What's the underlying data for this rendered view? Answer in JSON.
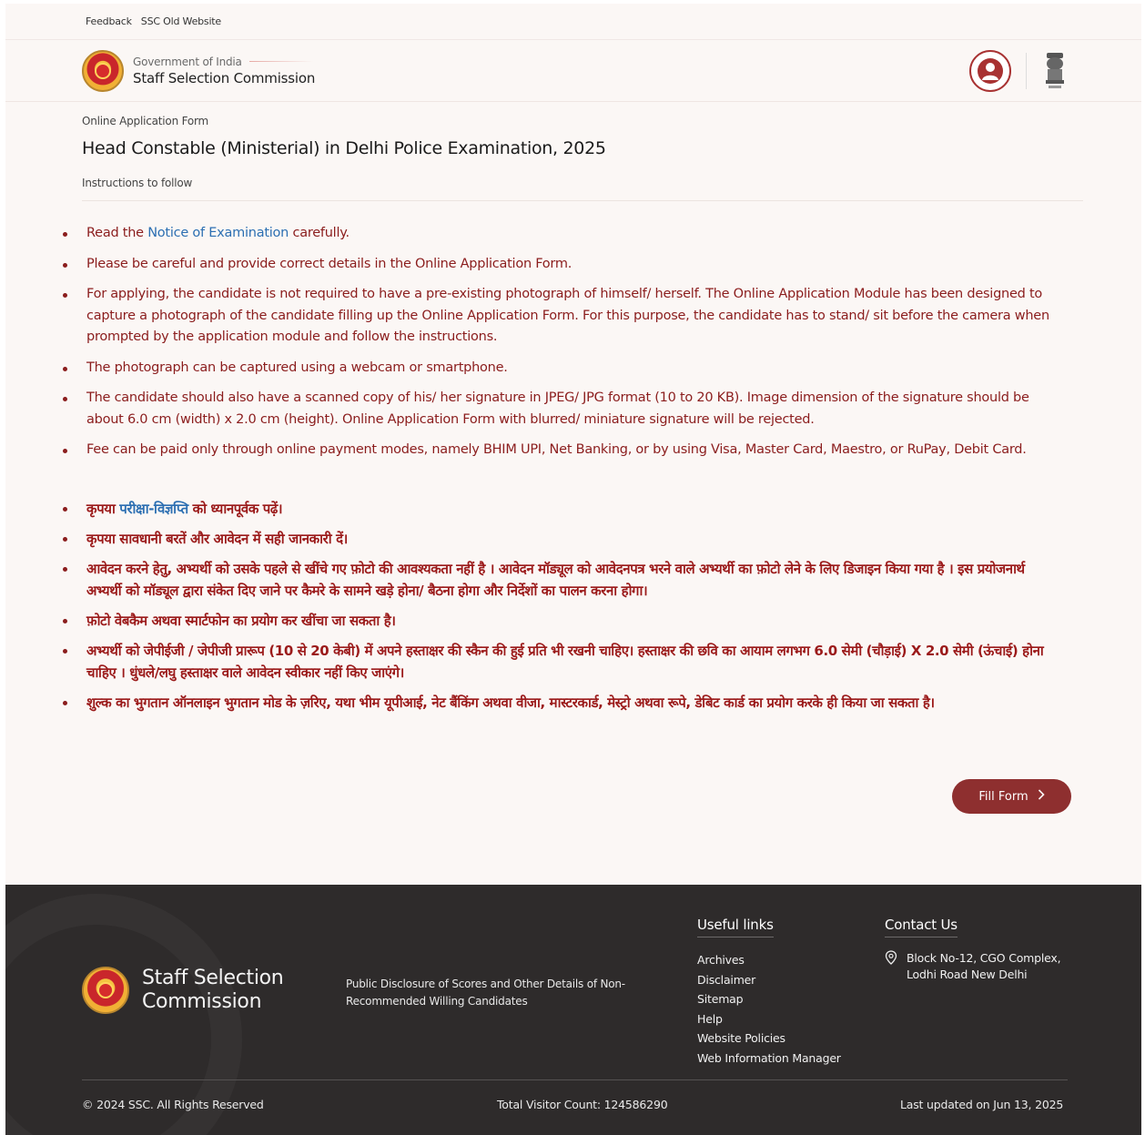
{
  "topbar": {
    "feedback": "Feedback",
    "old_site": "SSC Old Website"
  },
  "header": {
    "gov": "Government of India",
    "org": "Staff Selection Commission",
    "icons": [
      "ssc-emblem-icon",
      "user-profile-icon",
      "ashoka-emblem-icon"
    ]
  },
  "form": {
    "label": "Online Application Form",
    "title": "Head Constable (Ministerial) in Delhi Police Examination, 2025",
    "instructions_label": "Instructions to follow"
  },
  "english": {
    "item1_pre": "Read the ",
    "item1_link": "Notice of Examination",
    "item1_post": " carefully.",
    "item2": "Please be careful and provide correct details in the Online Application Form.",
    "item3": "For applying, the candidate is not required to have a pre-existing photograph of himself/ herself. The Online Application Module has been designed to capture a photograph of the candidate filling up the Online Application Form. For this purpose, the candidate has to stand/ sit before the camera when prompted by the application module and follow the instructions.",
    "item4": "The photograph can be captured using a webcam or smartphone.",
    "item5": "The candidate should also have a scanned copy of his/ her signature in JPEG/ JPG format (10 to 20 KB). Image dimension of the signature should be about 6.0 cm (width) x 2.0 cm (height). Online Application Form with blurred/ miniature signature will be rejected.",
    "item6": "Fee can be paid only through online payment modes, namely BHIM UPI, Net Banking, or by using Visa, Master Card, Maestro, or RuPay, Debit Card."
  },
  "hindi": {
    "item1_pre": "कृपया ",
    "item1_link": "परीक्षा-विज्ञप्ति",
    "item1_post": " को ध्यानपूर्वक पढ़ें।",
    "item2": "कृपया सावधानी बरतें और आवेदन में सही जानकारी दें।",
    "item3": "आवेदन करने हेतु, अभ्यर्थी को उसके पहले से खींचे गए फ़ोटो की आवश्यकता नहीं है । आवेदन मॉड्यूल को आवेदनपत्र भरने वाले अभ्यर्थी का फ़ोटो लेने के लिए डिजाइन किया गया है । इस प्रयोजनार्थ अभ्यर्थी को मॉड्यूल द्वारा संकेत दिए जाने पर कैमरे के सामने खड़े होना/ बैठना होगा और निर्देशों का पालन करना होगा।",
    "item4": "फ़ोटो वेबकैम अथवा स्मार्टफोन का प्रयोग कर खींचा जा सकता है।",
    "item5": "अभ्यर्थी को जेपीईजी / जेपीजी प्रारूप (10 से 20 केबी) में अपने हस्ताक्षर की स्कैन की हुई प्रति भी रखनी चाहिए। हस्ताक्षर की छवि का आयाम लगभग 6.0 सेमी (चौड़ाई) X 2.0 सेमी (ऊंचाई) होना चाहिए । धुंधले/लघु हस्ताक्षर वाले आवेदन स्वीकार नहीं किए जाएंगे।",
    "item6": "शुल्क का भुगतान ऑनलाइन भुगतान मोड के ज़रिए, यथा भीम यूपीआई, नेट बैंकिंग अथवा वीजा, मास्टरकार्ड, मेस्ट्रो अथवा रूपे, डेबिट कार्ड का प्रयोग करके ही किया जा सकता है।"
  },
  "actions": {
    "fill_form": "Fill Form"
  },
  "footer": {
    "brand": "Staff Selection Commission",
    "disclosure": "Public Disclosure of Scores and Other Details of Non-Recommended Willing Candidates",
    "useful_heading": "Useful links",
    "links": [
      "Archives",
      "Disclaimer",
      "Sitemap",
      "Help",
      "Website Policies",
      "Web Information Manager"
    ],
    "contact_heading": "Contact Us",
    "address": "Block No-12, CGO Complex, Lodhi Road New Delhi",
    "copyright": "© 2024 SSC. All Rights Reserved",
    "visitors": "Total Visitor Count: 124586290",
    "updated": "Last updated on Jun 13, 2025"
  },
  "colors": {
    "accent": "#8e2f2f",
    "instruction_text": "#8b1d1d",
    "link": "#2c6fb2",
    "footer_bg": "#2e2b2b",
    "page_bg": "#fbf7f5"
  }
}
